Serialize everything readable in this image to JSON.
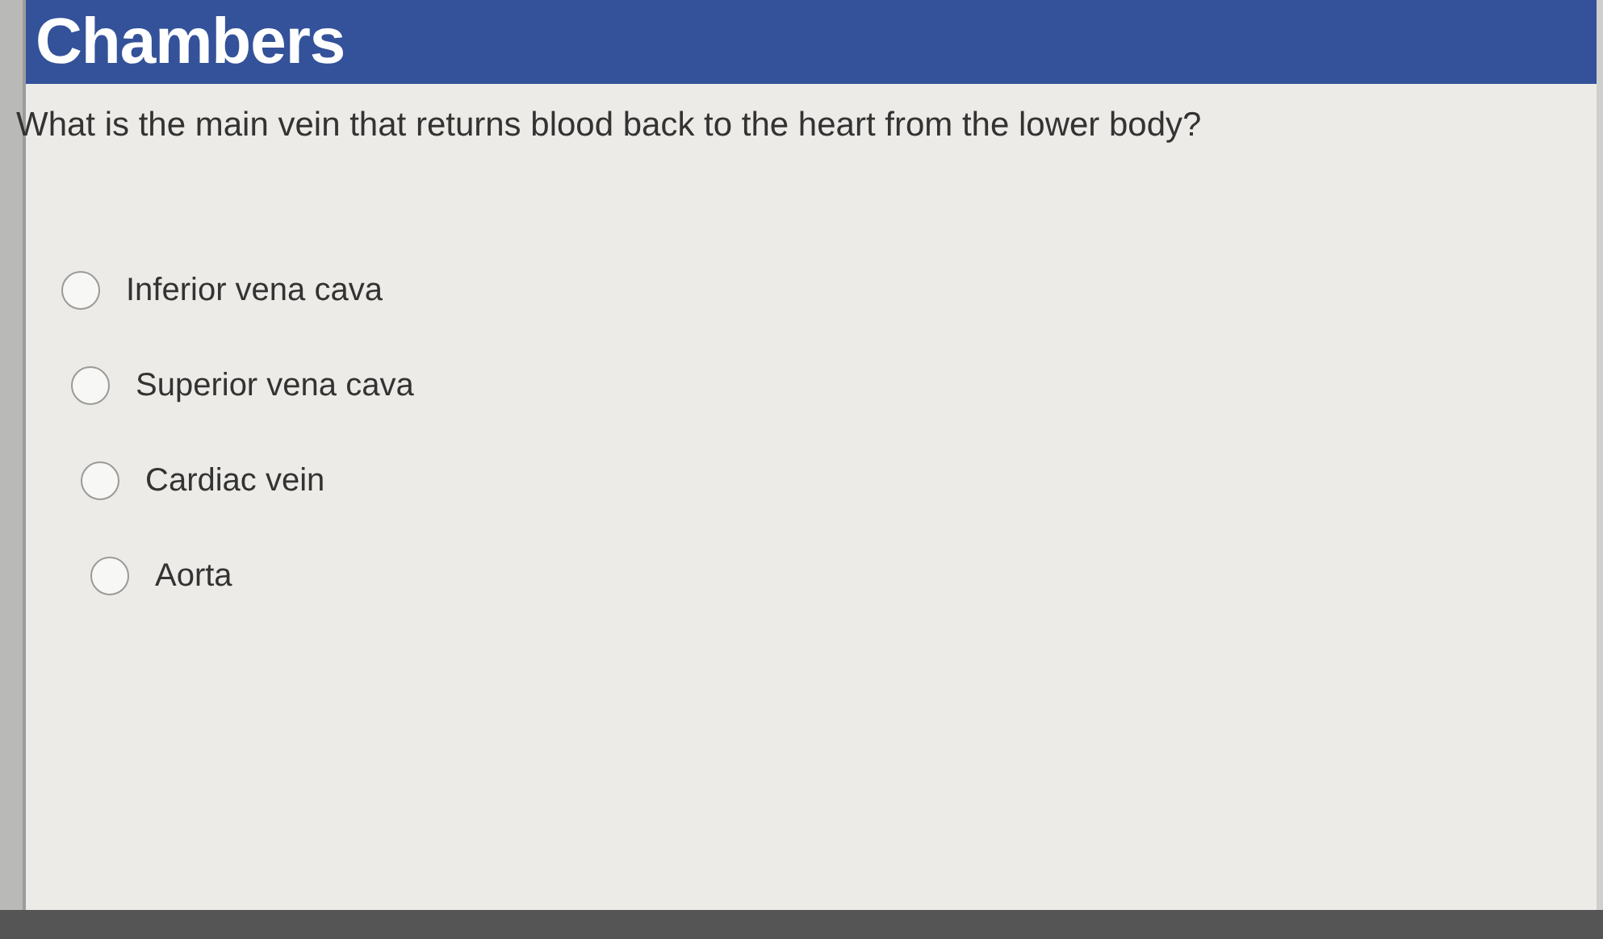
{
  "header": {
    "title": "Chambers"
  },
  "question": "What is the main vein that returns blood back to the heart from the lower body?",
  "options": [
    {
      "label": "Inferior vena cava",
      "selected": false
    },
    {
      "label": "Superior vena cava",
      "selected": false
    },
    {
      "label": "Cardiac vein",
      "selected": false
    },
    {
      "label": "Aorta",
      "selected": false
    }
  ]
}
